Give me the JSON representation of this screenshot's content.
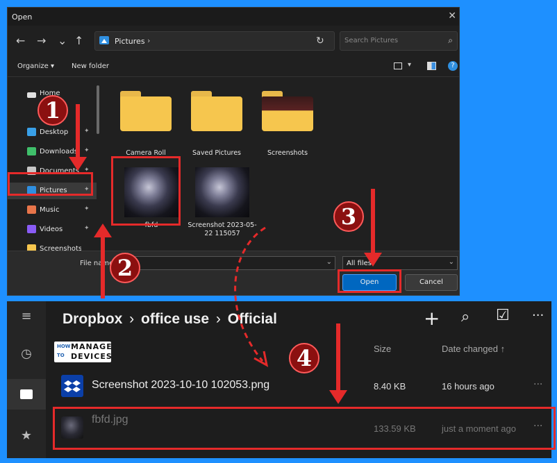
{
  "dialog": {
    "title": "Open",
    "close_glyph": "✕",
    "nav": {
      "back": "←",
      "forward": "→",
      "up": "↑",
      "refresh": "↻",
      "dropdown": "⌄"
    },
    "address": {
      "path": "Pictures",
      "chevron": "›"
    },
    "search": {
      "placeholder": "Search Pictures",
      "icon": "⌕"
    },
    "toolbar": {
      "organize": "Organize ▾",
      "new_folder": "New folder",
      "help": "?"
    },
    "sidebar": [
      {
        "label": "Home",
        "icon": "home-icon",
        "pinned": false,
        "color": "#e0e0e0"
      },
      {
        "label": "Desktop",
        "icon": "desktop-icon",
        "pinned": true,
        "color": "#39a0e8"
      },
      {
        "label": "Downloads",
        "icon": "download-icon",
        "pinned": true,
        "color": "#3fbf6a"
      },
      {
        "label": "Documents",
        "icon": "documents-icon",
        "pinned": true,
        "color": "#c7c7c7"
      },
      {
        "label": "Pictures",
        "icon": "pictures-icon",
        "pinned": true,
        "color": "#2f8fe0"
      },
      {
        "label": "Music",
        "icon": "music-icon",
        "pinned": true,
        "color": "#e8754a"
      },
      {
        "label": "Videos",
        "icon": "videos-icon",
        "pinned": true,
        "color": "#8a5cf6"
      },
      {
        "label": "Screenshots",
        "icon": "folder-icon",
        "pinned": false,
        "color": "#f6c64e"
      }
    ],
    "pin_glyph": "📌",
    "files": [
      {
        "label": "Camera Roll",
        "kind": "folder"
      },
      {
        "label": "Saved Pictures",
        "kind": "folder"
      },
      {
        "label": "Screenshots",
        "kind": "folder"
      },
      {
        "label": "fbfd",
        "kind": "image"
      },
      {
        "label": "Screenshot 2023-05-22 115057",
        "kind": "image"
      }
    ],
    "file_name_label": "File name:",
    "file_name_value": "",
    "file_type_value": "All files",
    "open_button": "Open",
    "cancel_button": "Cancel"
  },
  "dropbox": {
    "breadcrumb": [
      "Dropbox",
      "office use",
      "Official"
    ],
    "breadcrumb_sep": "›",
    "actions": {
      "add": "+",
      "search": "⌕",
      "select": "☑",
      "more": "···"
    },
    "logo": {
      "line1_a": "HOW",
      "line1_b": "MANAGE",
      "line2_a": "TO",
      "line2_b": "DEVICES"
    },
    "columns": {
      "size": "Size",
      "date": "Date changed ↑"
    },
    "files": [
      {
        "name": "Screenshot 2023-10-10 102053.png",
        "size": "8.40 KB",
        "date": "16 hours ago"
      },
      {
        "name": "fbfd.jpg",
        "size": "133.59 KB",
        "date": "just a moment ago"
      }
    ],
    "row_more": "···",
    "rail": {
      "menu": "≡",
      "recent": "◷",
      "files": "▇",
      "starred": "★"
    }
  },
  "annotations": {
    "step1": "1",
    "step2": "2",
    "step3": "3",
    "step4": "4"
  },
  "colors": {
    "accent_red": "#e52a2a",
    "primary_button": "#0067c0",
    "background": "#1e90ff"
  }
}
